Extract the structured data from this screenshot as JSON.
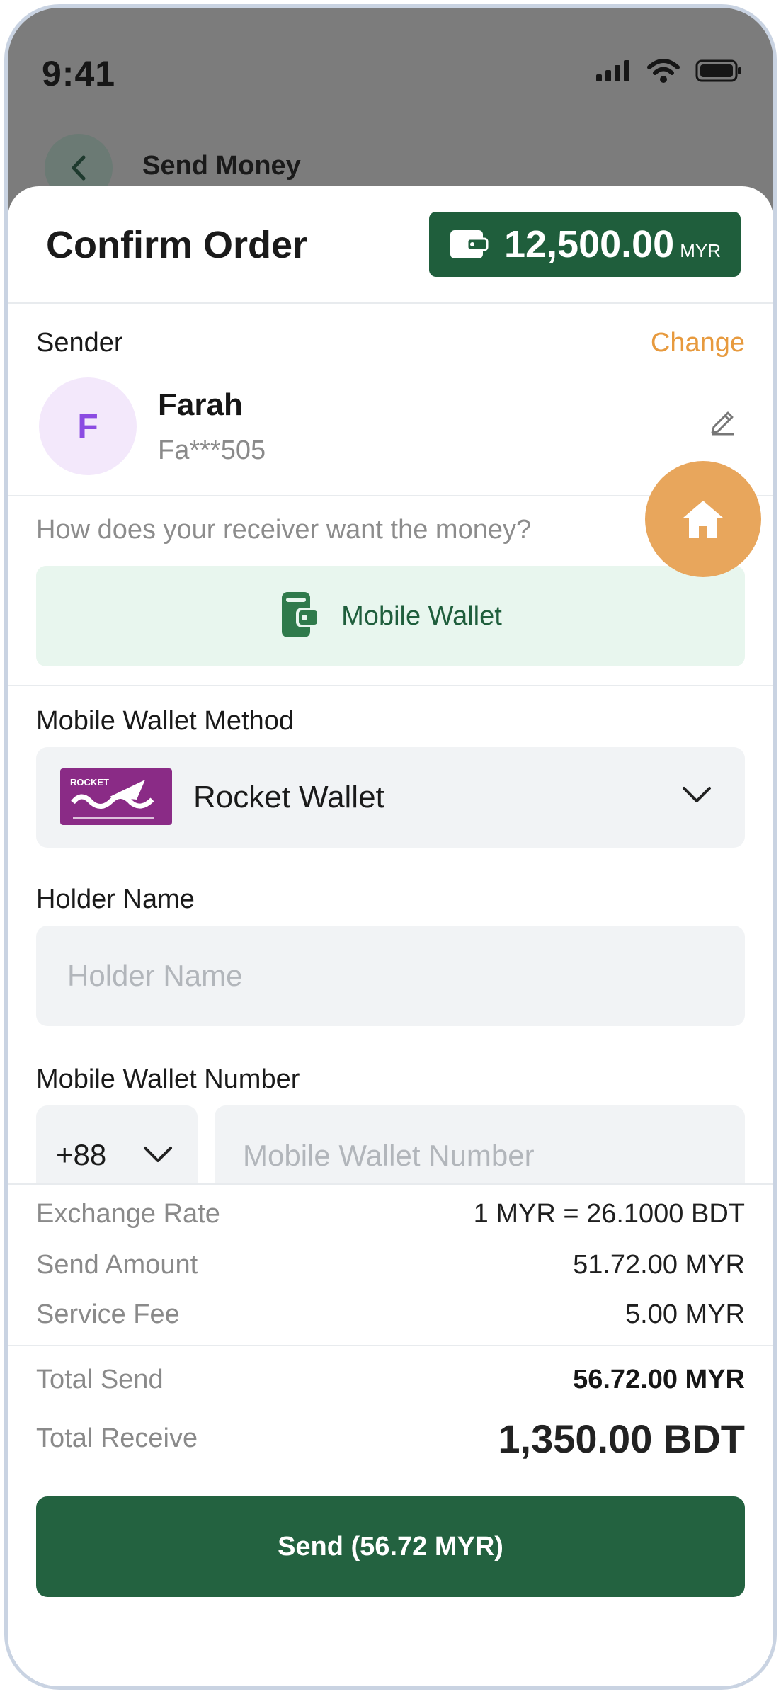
{
  "status_bar": {
    "time": "9:41"
  },
  "background_screen": {
    "title": "Send Money"
  },
  "sheet": {
    "title": "Confirm Order",
    "balance": {
      "amount": "12,500.00",
      "currency": "MYR"
    }
  },
  "sender": {
    "label": "Sender",
    "change_label": "Change",
    "avatar_initial": "F",
    "name": "Farah",
    "masked_id": "Fa***505"
  },
  "receive_method": {
    "question": "How does your receiver want the money?",
    "selected_label": "Mobile Wallet"
  },
  "wallet_method": {
    "label": "Mobile Wallet Method",
    "selected": "Rocket Wallet",
    "logo_text": "ROCKET"
  },
  "holder_name": {
    "label": "Holder Name",
    "placeholder": "Holder Name",
    "value": ""
  },
  "wallet_number": {
    "label": "Mobile Wallet Number",
    "country_code": "+88",
    "placeholder": "Mobile Wallet Number",
    "value": ""
  },
  "summary": {
    "exchange_rate_label": "Exchange Rate",
    "exchange_rate_value": "1 MYR = 26.1000 BDT",
    "send_amount_label": "Send Amount",
    "send_amount_value": "51.72.00 MYR",
    "service_fee_label": "Service Fee",
    "service_fee_value": "5.00 MYR",
    "total_send_label": "Total Send",
    "total_send_value": "56.72.00 MYR",
    "total_receive_label": "Total Receive",
    "total_receive_value": "1,350.00 BDT"
  },
  "send_button": {
    "label": "Send (56.72 MYR)"
  },
  "colors": {
    "primary": "#1f5e3c",
    "accent": "#e79a3e",
    "fab": "#e8a65c",
    "method_bg": "#e8f6ee",
    "rocket_brand": "#8a2b86"
  }
}
